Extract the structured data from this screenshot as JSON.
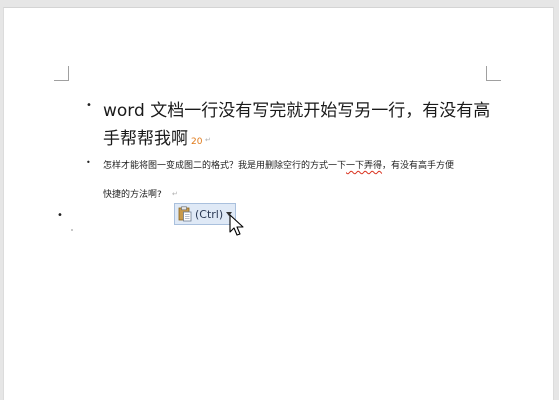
{
  "document": {
    "bullet_glyph": "•",
    "paragraph1": {
      "line1": "word 文档一行没有写完就开始写另一行，有没有高",
      "line2": "手帮帮我啊",
      "answer_count": "20"
    },
    "paragraph2": {
      "line1_before": "怎样才能将图一变成图二的格式？我是用删除空行的方式一下",
      "line1_underlined": "一下弄得",
      "line1_after": "，有没有高手方便",
      "line2": "快捷的方法啊?"
    }
  },
  "paste_options": {
    "label": "(Ctrl)",
    "icon": "clipboard-paste-icon"
  },
  "colors": {
    "count_accent": "#e07a1a",
    "spellcheck_underline": "#d9301d",
    "paste_button_bg": "#dfe9f6"
  }
}
